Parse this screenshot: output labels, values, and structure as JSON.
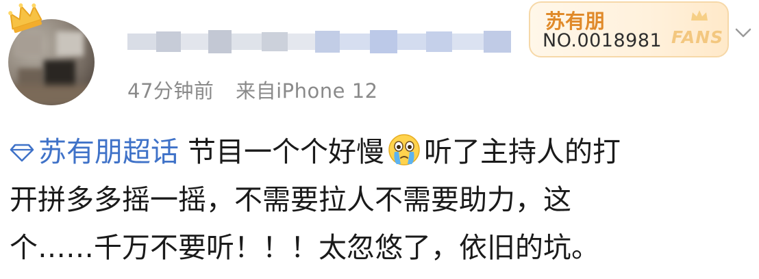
{
  "post": {
    "time_ago": "47分钟前",
    "source": "来自iPhone 12",
    "fans_badge": {
      "name": "苏有朋",
      "number": "NO.0018981",
      "label": "FANS"
    },
    "topic": "苏有朋超话",
    "text_line1": "节目一个个好慢",
    "text_line1_after": "听了主持人的打",
    "text_line2": "开拼多多摇一摇，不需要拉人不需要助力，这",
    "text_line3": "个……千万不要听！！！太忽悠了，依旧的坑。",
    "emoji": "crying-face-emoji"
  },
  "colors": {
    "topic_blue": "#3f72c8",
    "meta_gray": "#8a8a8a",
    "badge_orange": "#e08a2a",
    "crown_gold": "#f5b93a"
  }
}
